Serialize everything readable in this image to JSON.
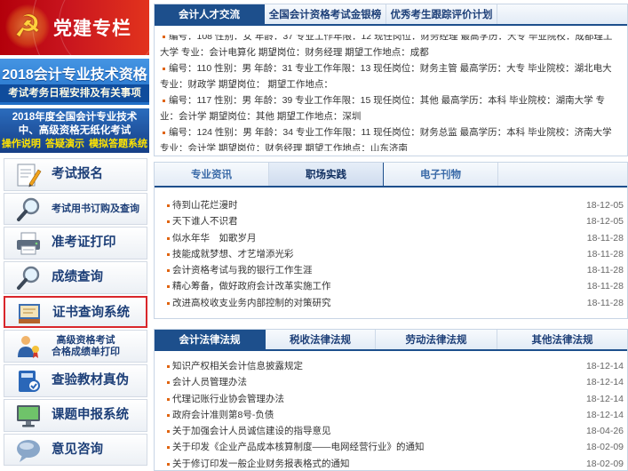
{
  "sidebar": {
    "party_banner": {
      "title": "党建专栏",
      "icon": "party-emblem-icon"
    },
    "exam_banner": {
      "title": "2018会计专业技术资格",
      "subtitle": "考试考务日程安排及有关事项"
    },
    "paperless_banner": {
      "line1": "2018年度全国会计专业技术",
      "line2": "中、高级资格无纸化考试",
      "links": [
        "操作说明",
        "答疑演示",
        "模拟答题系统"
      ]
    },
    "menu": [
      {
        "label": "考试报名",
        "icon": "notepad-pencil-icon"
      },
      {
        "label": "考试用书订购及查询",
        "icon": "magnifier-icon"
      },
      {
        "label": "准考证打印",
        "icon": "printer-icon"
      },
      {
        "label": "成绩查询",
        "icon": "magnifier-icon"
      },
      {
        "label": "证书查询系统",
        "icon": "certificate-book-icon",
        "highlighted": true
      },
      {
        "label": "高级资格考试",
        "label2": "合格成绩单打印",
        "icon": "person-award-icon"
      },
      {
        "label": "查验教材真伪",
        "icon": "book-verify-icon"
      },
      {
        "label": "课题申报系统",
        "icon": "monitor-icon"
      },
      {
        "label": "意见咨询",
        "icon": "speech-bubble-icon"
      }
    ]
  },
  "talent_panel": {
    "tabs": [
      "会计人才交流",
      "全国会计资格考试金银榜",
      "优秀考生跟踪评价计划"
    ],
    "active_tab": 0,
    "records": [
      "编号：108 性别：女 年龄：37 专业工作年限：12 现任岗位：财务经理 最高学历：大专 毕业院校：成都理工大学 专业：会计电算化 期望岗位：财务经理 期望工作地点：成都",
      "编号：110 性别：男 年龄：31 专业工作年限：13 现任岗位：财务主管 最高学历：大专 毕业院校：湖北电大 专业：财政学 期望岗位： 期望工作地点：",
      "编号：117 性别：男 年龄：39 专业工作年限：15 现任岗位：其他 最高学历：本科 毕业院校：湖南大学 专业：会计学 期望岗位：其他 期望工作地点：深圳",
      "编号：124 性别：男 年龄：34 专业工作年限：11 现任岗位：财务总监 最高学历：本科 毕业院校：济南大学 专业：会计学 期望岗位：财务经理 期望工作地点：山东济南"
    ]
  },
  "practice_panel": {
    "tabs": [
      "专业资讯",
      "职场实践",
      "电子刊物"
    ],
    "active_tab": 1,
    "items": [
      {
        "title": "待到山花烂漫时",
        "date": "18-12-05"
      },
      {
        "title": "天下谁人不识君",
        "date": "18-12-05"
      },
      {
        "title": "似水年华　如歌岁月",
        "date": "18-11-28"
      },
      {
        "title": "技能成就梦想、才艺增添光彩",
        "date": "18-11-28"
      },
      {
        "title": "会计资格考试与我的银行工作生涯",
        "date": "18-11-28"
      },
      {
        "title": "精心筹备，做好政府会计改革实施工作",
        "date": "18-11-28"
      },
      {
        "title": "改进高校收支业务内部控制的对策研究",
        "date": "18-11-28"
      }
    ]
  },
  "law_panel": {
    "tabs": [
      "会计法律法规",
      "税收法律法规",
      "劳动法律法规",
      "其他法律法规"
    ],
    "active_tab": 0,
    "items": [
      {
        "title": "知识产权相关会计信息披露规定",
        "date": "18-12-14"
      },
      {
        "title": "会计人员管理办法",
        "date": "18-12-14"
      },
      {
        "title": "代理记账行业协会管理办法",
        "date": "18-12-14"
      },
      {
        "title": "政府会计准则第8号-负债",
        "date": "18-12-14"
      },
      {
        "title": "关于加强会计人员诚信建设的指导意见",
        "date": "18-04-26"
      },
      {
        "title": "关于印发《企业产品成本核算制度——电网经营行业》的通知",
        "date": "18-02-09"
      },
      {
        "title": "关于修订印发一般企业财务报表格式的通知",
        "date": "18-02-09"
      }
    ]
  },
  "colors": {
    "navy": "#1d4f8c",
    "party_red": "#c9151e",
    "highlight_red": "#d9262b",
    "bullet": "#e0640f",
    "link_blue": "#1d3f78",
    "yellow": "#ffe400"
  }
}
